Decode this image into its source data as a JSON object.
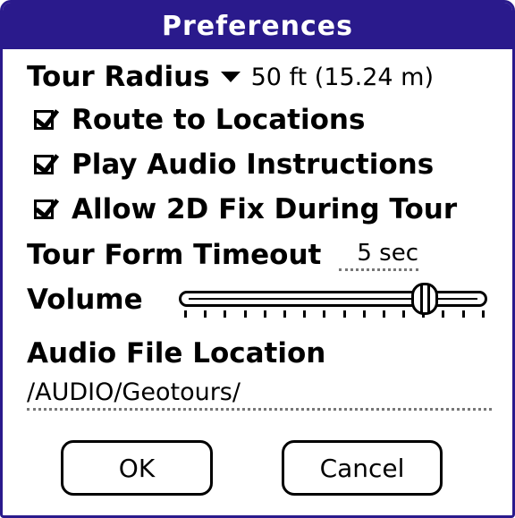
{
  "dialog": {
    "title": "Preferences"
  },
  "tour_radius": {
    "label": "Tour Radius",
    "value": "50 ft (15.24 m)"
  },
  "checkboxes": [
    {
      "label": "Route to Locations",
      "checked": true
    },
    {
      "label": "Play Audio Instructions",
      "checked": true
    },
    {
      "label": "Allow 2D Fix During Tour",
      "checked": true
    }
  ],
  "tour_form_timeout": {
    "label": "Tour Form Timeout",
    "value": "5 sec"
  },
  "volume": {
    "label": "Volume",
    "level": 0.8,
    "tick_count": 16
  },
  "audio_file_location": {
    "label": "Audio File Location",
    "value": "/AUDIO/Geotours/"
  },
  "buttons": {
    "ok_label": "OK",
    "cancel_label": "Cancel"
  },
  "colors": {
    "title_bar": "#2a1a8c",
    "title_text": "#ffffff"
  }
}
